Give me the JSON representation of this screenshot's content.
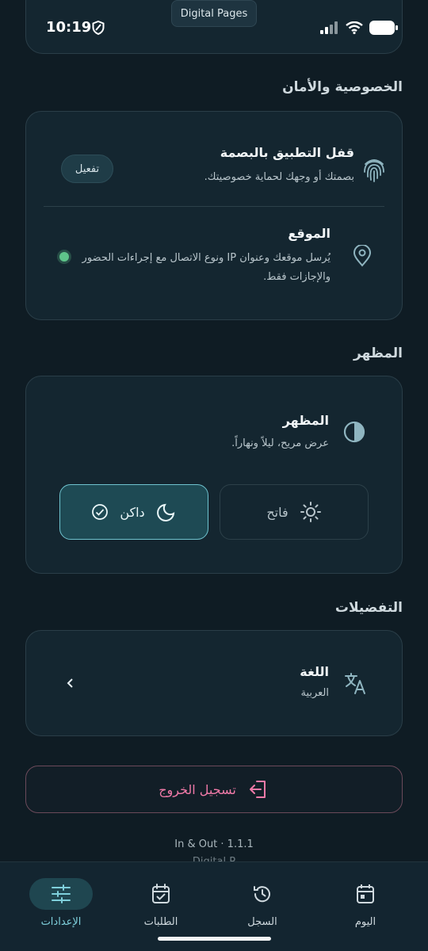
{
  "status_bar": {
    "time": "10:19",
    "app_label": "Digital Pages"
  },
  "privacy": {
    "title": "الخصوصية والأمان",
    "biometric": {
      "title": "قفل التطبيق بالبصمة",
      "subtitle": "بصمتك أو وجهك لحماية خصوصيتك.",
      "button": "تفعيل"
    },
    "location": {
      "title": "الموقع",
      "subtitle_line1": "يُرسل موقعك وعنوان IP ونوع الاتصال مع إجراءات الحضور",
      "subtitle_line2": "والإجازات فقط.",
      "status_color": "#5ec48a"
    }
  },
  "appearance": {
    "title": "المظهر",
    "row_title": "المظهر",
    "row_subtitle": "عرض مريح، ليلاً ونهاراً.",
    "dark_label": "داكن",
    "light_label": "فاتح",
    "selected": "dark"
  },
  "preferences": {
    "title": "التفضيلات",
    "language": {
      "title": "اللغة",
      "value": "العربية"
    }
  },
  "logout": {
    "label": "تسجيل الخروج"
  },
  "version": {
    "line1": "In & Out · 1.1.1",
    "line2": "Digital P"
  },
  "nav": {
    "items": [
      {
        "label": "اليوم",
        "icon": "calendar-today-icon"
      },
      {
        "label": "السجل",
        "icon": "history-icon"
      },
      {
        "label": "الطلبات",
        "icon": "calendar-check-icon"
      },
      {
        "label": "الإعدادات",
        "icon": "sliders-icon"
      }
    ],
    "active": "الإعدادات"
  },
  "colors": {
    "accent": "#7fd0dc",
    "logout": "#f07aa8",
    "background": "#0f1c24",
    "card": "#142630"
  }
}
